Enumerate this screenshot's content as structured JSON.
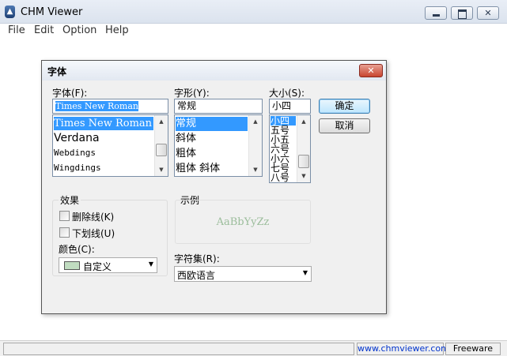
{
  "app": {
    "title": "CHM Viewer",
    "icon": "book-icon"
  },
  "menu": [
    "File",
    "Edit",
    "Option",
    "Help"
  ],
  "dialog": {
    "title": "字体",
    "font_label": "字体(F):",
    "font_value": "Times New Roman",
    "fonts": [
      "Times New Roman",
      "Verdana",
      "Webdings",
      "Wingdings"
    ],
    "fonts_selected": 0,
    "style_label": "字形(Y):",
    "style_value": "常规",
    "styles": [
      "常规",
      "斜体",
      "粗体",
      "粗体 斜体"
    ],
    "styles_selected": 0,
    "size_label": "大小(S):",
    "size_value": "小四",
    "sizes": [
      "小四",
      "五号",
      "小五",
      "六号",
      "小六",
      "七号",
      "八号"
    ],
    "sizes_selected": 0,
    "ok_label": "确定",
    "cancel_label": "取消",
    "effects": {
      "group_label": "效果",
      "strikeout_label": "删除线(K)",
      "strikeout_checked": false,
      "underline_label": "下划线(U)",
      "underline_checked": false,
      "color_label": "颜色(C):",
      "color_value": "自定义",
      "color_swatch": "#c0dcc0"
    },
    "sample": {
      "group_label": "示例",
      "text": "AaBbYyZz",
      "text_color": "#9bbd9b"
    },
    "charset_label": "字符集(R):",
    "charset_value": "西欧语言"
  },
  "statusbar": {
    "main": "",
    "link": "www.chmviewer.com",
    "license": "Freeware"
  },
  "colors": {
    "selection": "#3399ff",
    "link": "#0033cc",
    "close_button": "#c8452f"
  }
}
